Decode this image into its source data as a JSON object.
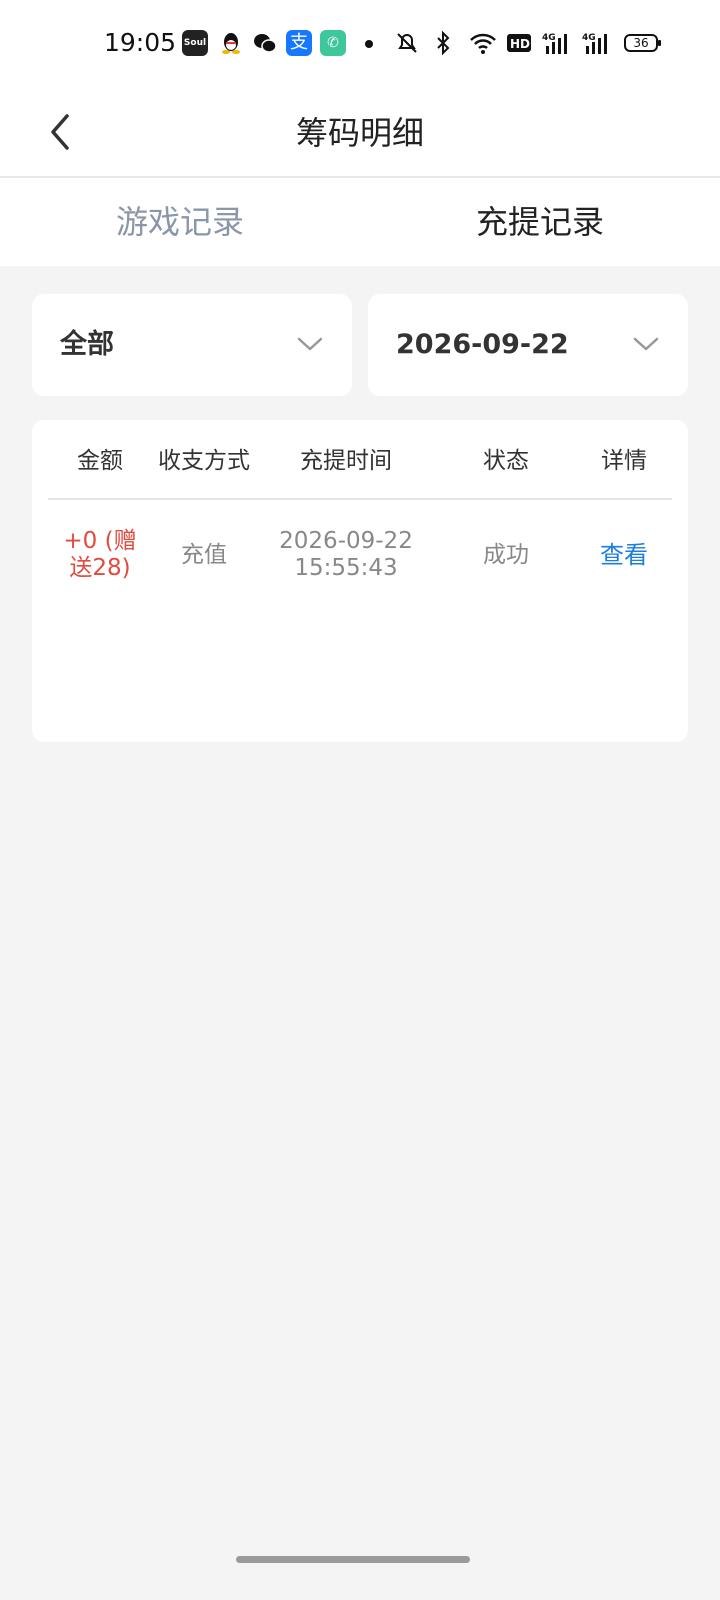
{
  "status_bar": {
    "time": "19:05",
    "app_soul_label": "Soul",
    "alipay_glyph": "支",
    "battery": "36",
    "icons": [
      "soul-icon",
      "qq-icon",
      "wechat-icon",
      "alipay-icon",
      "phone-icon",
      "notification-dot-icon",
      "mute-icon",
      "bluetooth-icon",
      "wifi-icon",
      "hd-icon",
      "signal-4g-icon",
      "signal-4g-icon",
      "battery-icon"
    ]
  },
  "header": {
    "title": "筹码明细",
    "back_icon": "chevron-left-icon"
  },
  "tabs": [
    {
      "label": "游戏记录",
      "active": false
    },
    {
      "label": "充提记录",
      "active": true
    }
  ],
  "filters": {
    "type": {
      "value": "全部",
      "icon": "chevron-down-icon"
    },
    "date": {
      "value": "2026-09-22",
      "icon": "chevron-down-icon"
    }
  },
  "table": {
    "headers": [
      "金额",
      "收支方式",
      "充提时间",
      "状态",
      "详情"
    ],
    "rows": [
      {
        "amount": "+0 (赠送28)",
        "method": "充值",
        "date": "2026-09-22",
        "time": "15:55:43",
        "status": "成功",
        "detail": "查看"
      }
    ]
  },
  "colors": {
    "amount": "#e24b40",
    "link": "#1a7ee6",
    "inactive_tab": "#8a97a8",
    "background": "#f4f4f4"
  }
}
